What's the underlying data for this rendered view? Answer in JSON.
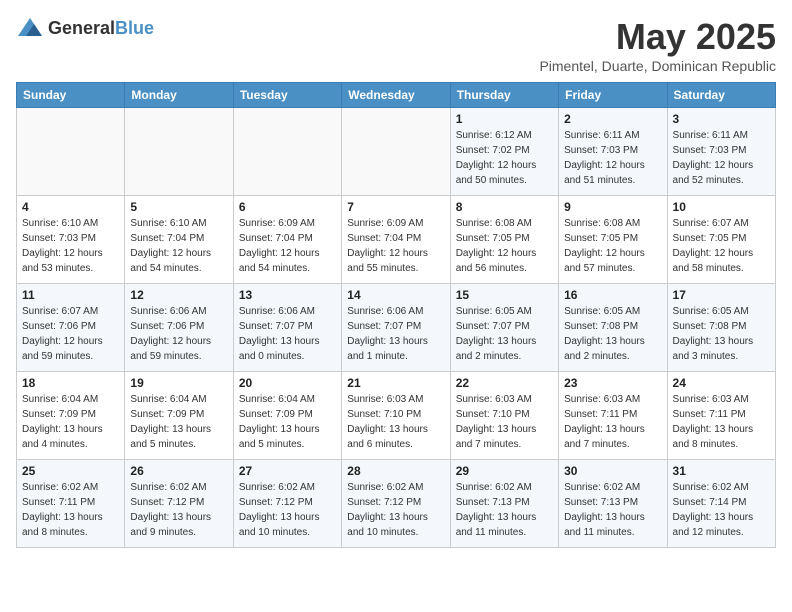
{
  "logo": {
    "general": "General",
    "blue": "Blue"
  },
  "header": {
    "month": "May 2025",
    "location": "Pimentel, Duarte, Dominican Republic"
  },
  "weekdays": [
    "Sunday",
    "Monday",
    "Tuesday",
    "Wednesday",
    "Thursday",
    "Friday",
    "Saturday"
  ],
  "weeks": [
    [
      {
        "day": "",
        "info": ""
      },
      {
        "day": "",
        "info": ""
      },
      {
        "day": "",
        "info": ""
      },
      {
        "day": "",
        "info": ""
      },
      {
        "day": "1",
        "info": "Sunrise: 6:12 AM\nSunset: 7:02 PM\nDaylight: 12 hours and 50 minutes."
      },
      {
        "day": "2",
        "info": "Sunrise: 6:11 AM\nSunset: 7:03 PM\nDaylight: 12 hours and 51 minutes."
      },
      {
        "day": "3",
        "info": "Sunrise: 6:11 AM\nSunset: 7:03 PM\nDaylight: 12 hours and 52 minutes."
      }
    ],
    [
      {
        "day": "4",
        "info": "Sunrise: 6:10 AM\nSunset: 7:03 PM\nDaylight: 12 hours and 53 minutes."
      },
      {
        "day": "5",
        "info": "Sunrise: 6:10 AM\nSunset: 7:04 PM\nDaylight: 12 hours and 54 minutes."
      },
      {
        "day": "6",
        "info": "Sunrise: 6:09 AM\nSunset: 7:04 PM\nDaylight: 12 hours and 54 minutes."
      },
      {
        "day": "7",
        "info": "Sunrise: 6:09 AM\nSunset: 7:04 PM\nDaylight: 12 hours and 55 minutes."
      },
      {
        "day": "8",
        "info": "Sunrise: 6:08 AM\nSunset: 7:05 PM\nDaylight: 12 hours and 56 minutes."
      },
      {
        "day": "9",
        "info": "Sunrise: 6:08 AM\nSunset: 7:05 PM\nDaylight: 12 hours and 57 minutes."
      },
      {
        "day": "10",
        "info": "Sunrise: 6:07 AM\nSunset: 7:05 PM\nDaylight: 12 hours and 58 minutes."
      }
    ],
    [
      {
        "day": "11",
        "info": "Sunrise: 6:07 AM\nSunset: 7:06 PM\nDaylight: 12 hours and 59 minutes."
      },
      {
        "day": "12",
        "info": "Sunrise: 6:06 AM\nSunset: 7:06 PM\nDaylight: 12 hours and 59 minutes."
      },
      {
        "day": "13",
        "info": "Sunrise: 6:06 AM\nSunset: 7:07 PM\nDaylight: 13 hours and 0 minutes."
      },
      {
        "day": "14",
        "info": "Sunrise: 6:06 AM\nSunset: 7:07 PM\nDaylight: 13 hours and 1 minute."
      },
      {
        "day": "15",
        "info": "Sunrise: 6:05 AM\nSunset: 7:07 PM\nDaylight: 13 hours and 2 minutes."
      },
      {
        "day": "16",
        "info": "Sunrise: 6:05 AM\nSunset: 7:08 PM\nDaylight: 13 hours and 2 minutes."
      },
      {
        "day": "17",
        "info": "Sunrise: 6:05 AM\nSunset: 7:08 PM\nDaylight: 13 hours and 3 minutes."
      }
    ],
    [
      {
        "day": "18",
        "info": "Sunrise: 6:04 AM\nSunset: 7:09 PM\nDaylight: 13 hours and 4 minutes."
      },
      {
        "day": "19",
        "info": "Sunrise: 6:04 AM\nSunset: 7:09 PM\nDaylight: 13 hours and 5 minutes."
      },
      {
        "day": "20",
        "info": "Sunrise: 6:04 AM\nSunset: 7:09 PM\nDaylight: 13 hours and 5 minutes."
      },
      {
        "day": "21",
        "info": "Sunrise: 6:03 AM\nSunset: 7:10 PM\nDaylight: 13 hours and 6 minutes."
      },
      {
        "day": "22",
        "info": "Sunrise: 6:03 AM\nSunset: 7:10 PM\nDaylight: 13 hours and 7 minutes."
      },
      {
        "day": "23",
        "info": "Sunrise: 6:03 AM\nSunset: 7:11 PM\nDaylight: 13 hours and 7 minutes."
      },
      {
        "day": "24",
        "info": "Sunrise: 6:03 AM\nSunset: 7:11 PM\nDaylight: 13 hours and 8 minutes."
      }
    ],
    [
      {
        "day": "25",
        "info": "Sunrise: 6:02 AM\nSunset: 7:11 PM\nDaylight: 13 hours and 8 minutes."
      },
      {
        "day": "26",
        "info": "Sunrise: 6:02 AM\nSunset: 7:12 PM\nDaylight: 13 hours and 9 minutes."
      },
      {
        "day": "27",
        "info": "Sunrise: 6:02 AM\nSunset: 7:12 PM\nDaylight: 13 hours and 10 minutes."
      },
      {
        "day": "28",
        "info": "Sunrise: 6:02 AM\nSunset: 7:12 PM\nDaylight: 13 hours and 10 minutes."
      },
      {
        "day": "29",
        "info": "Sunrise: 6:02 AM\nSunset: 7:13 PM\nDaylight: 13 hours and 11 minutes."
      },
      {
        "day": "30",
        "info": "Sunrise: 6:02 AM\nSunset: 7:13 PM\nDaylight: 13 hours and 11 minutes."
      },
      {
        "day": "31",
        "info": "Sunrise: 6:02 AM\nSunset: 7:14 PM\nDaylight: 13 hours and 12 minutes."
      }
    ]
  ]
}
